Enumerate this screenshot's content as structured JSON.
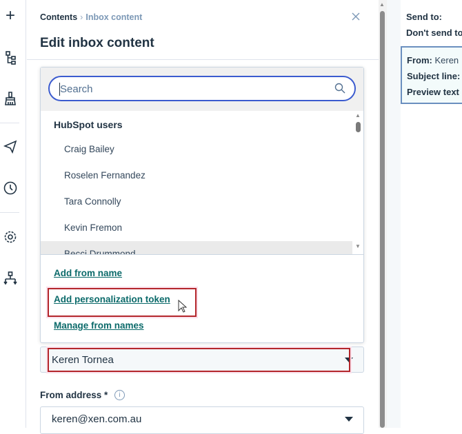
{
  "rail": {
    "icons": [
      "plus-icon",
      "tree-icon",
      "brush-icon",
      "send-icon",
      "clock-icon",
      "gear-icon",
      "hierarchy-icon"
    ]
  },
  "panel": {
    "breadcrumb": {
      "parent": "Contents",
      "separator": "›",
      "current": "Inbox content"
    },
    "title": "Edit inbox content",
    "close_icon": "close-icon"
  },
  "dropdown": {
    "search_placeholder": "Search",
    "group_header": "HubSpot users",
    "users": [
      "Craig Bailey",
      "Roselen Fernandez",
      "Tara Connolly",
      "Kevin Fremon",
      "Becci Drummond"
    ],
    "links": [
      "Add from name",
      "Add personalization token",
      "Manage from names"
    ]
  },
  "from_name": {
    "value": "Keren Tornea"
  },
  "from_address": {
    "label": "From address *",
    "value": "keren@xen.com.au"
  },
  "preview": {
    "send_to": "Send to:",
    "dont_send": "Don't send to",
    "from_label": "From:",
    "from_value": "Keren",
    "subject": "Subject line:",
    "preview_text": "Preview text"
  },
  "colors": {
    "accent": "#3b5bcf",
    "link": "#0b6a6a",
    "highlight": "#b3262b"
  }
}
